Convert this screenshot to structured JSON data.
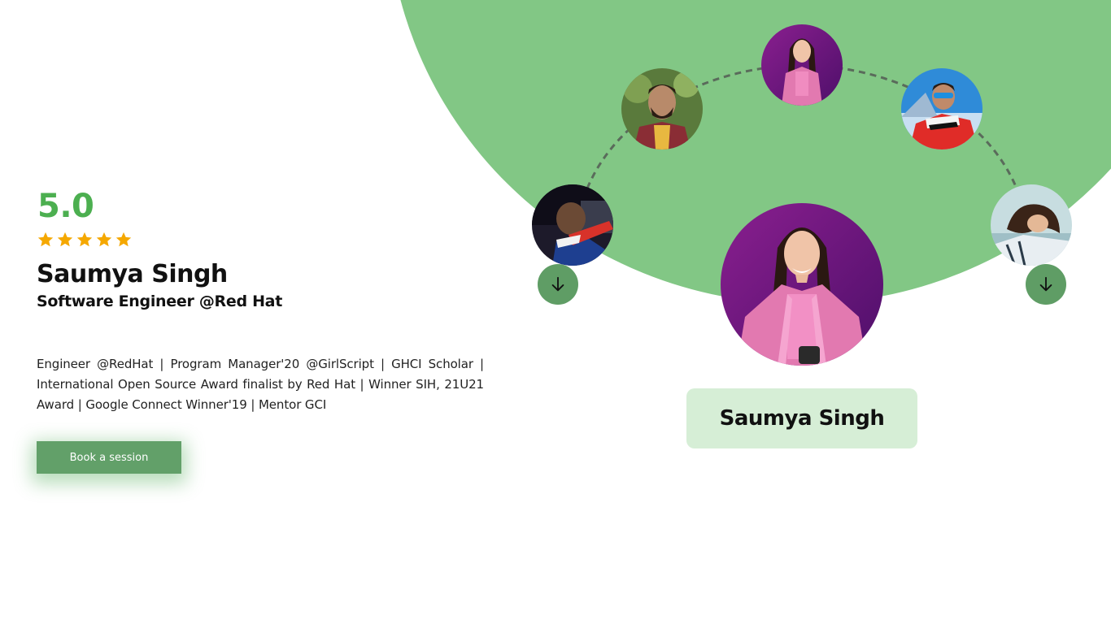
{
  "mentor": {
    "rating": "5.0",
    "stars": 5,
    "name": "Saumya Singh",
    "role": "Software Engineer @Red Hat",
    "bio": "Engineer @RedHat | Program Manager'20 @GirlScript | GHCI Scholar | International Open Source Award finalist by Red Hat | Winner SIH, 21U21 Award | Google Connect Winner'19 | Mentor GCI",
    "cta_label": "Book a session"
  },
  "carousel": {
    "selected_name": "Saumya Singh",
    "prev_icon": "arrow-down-icon",
    "next_icon": "arrow-down-icon"
  },
  "colors": {
    "accent_green": "#82c785",
    "rating_green": "#4caf50",
    "button_green": "#62a069",
    "star_gold": "#f5a800",
    "card_bg": "#d6eed6"
  }
}
